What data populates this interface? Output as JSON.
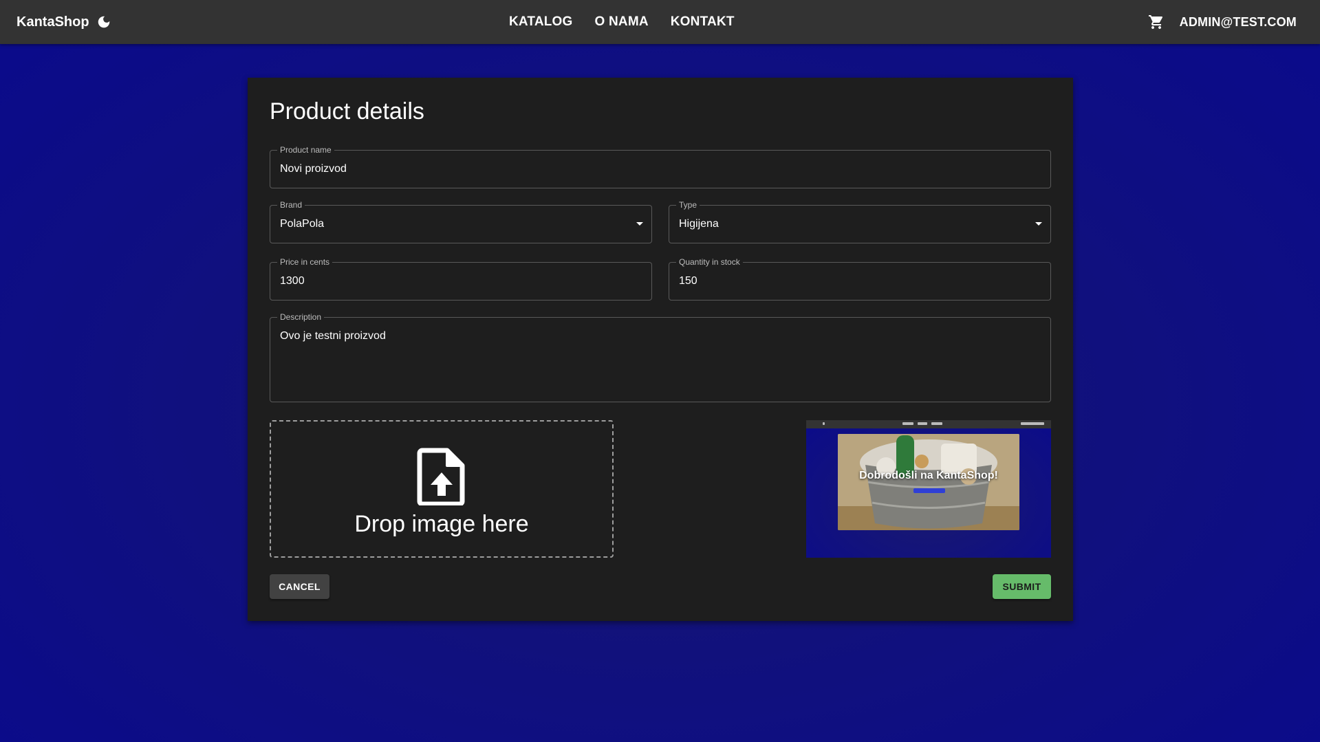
{
  "header": {
    "brand": "KantaShop",
    "nav": [
      "KATALOG",
      "O NAMA",
      "KONTAKT"
    ],
    "account": "ADMIN@TEST.COM"
  },
  "form": {
    "title": "Product details",
    "product_name": {
      "label": "Product name",
      "value": "Novi proizvod"
    },
    "brand": {
      "label": "Brand",
      "value": "PolaPola"
    },
    "type": {
      "label": "Type",
      "value": "Higijena"
    },
    "price": {
      "label": "Price in cents",
      "value": "1300"
    },
    "quantity": {
      "label": "Quantity in stock",
      "value": "150"
    },
    "description": {
      "label": "Description",
      "value": "Ovo je testni proizvod"
    },
    "dropzone_text": "Drop image here",
    "preview_caption": "Dobrodošli na KantaShop!",
    "cancel_label": "CANCEL",
    "submit_label": "SUBMIT"
  },
  "colors": {
    "appbar": "#333333",
    "card": "#1e1e1e",
    "background": "#0a0a8c",
    "submit": "#66bb6a"
  },
  "icons": {
    "theme": "moon-icon",
    "cart": "cart-icon",
    "upload": "file-upload-icon",
    "dropdown": "arrow-drop-down-icon"
  }
}
